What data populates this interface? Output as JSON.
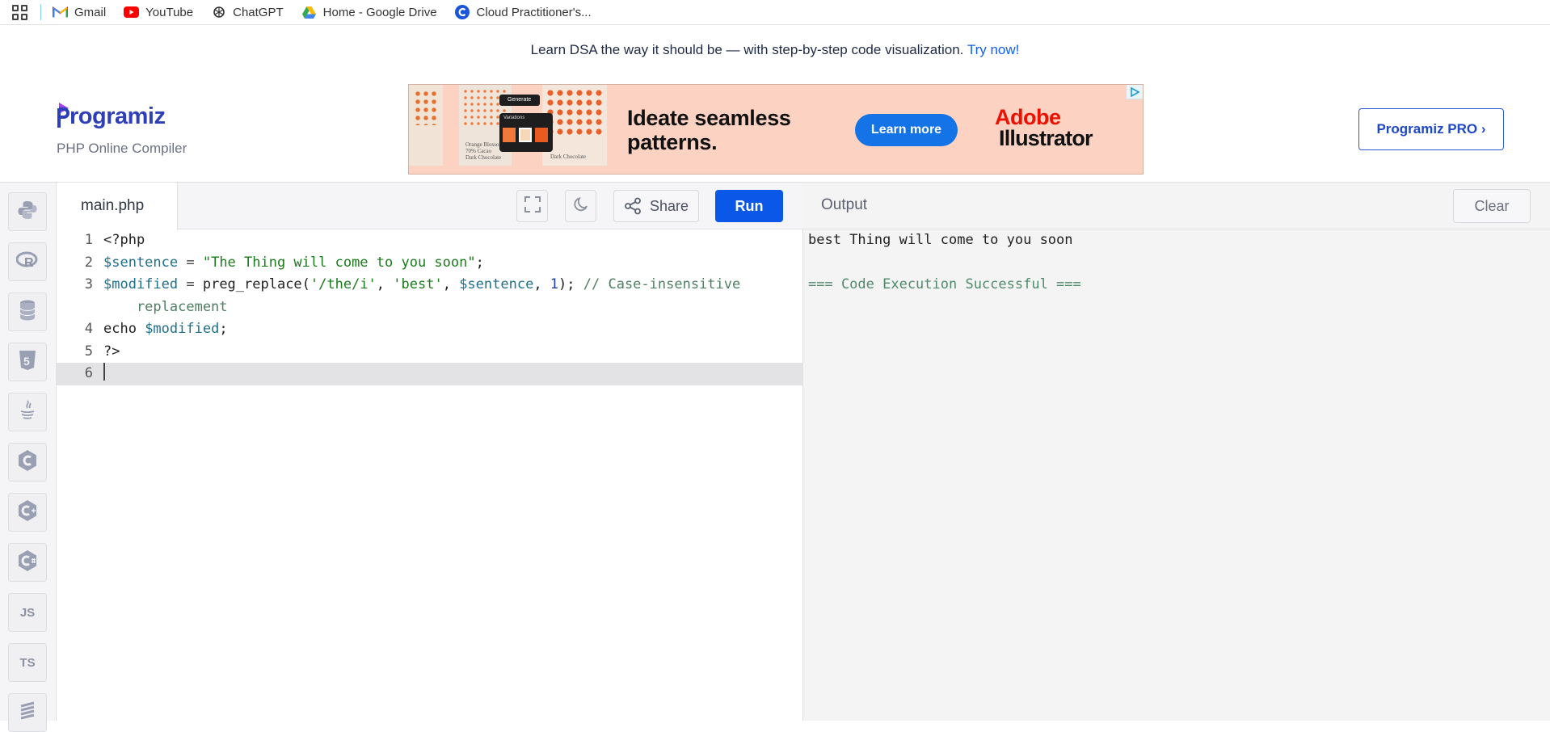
{
  "bookmarks": [
    {
      "label": "Gmail",
      "icon": "gmail-icon"
    },
    {
      "label": "YouTube",
      "icon": "youtube-icon"
    },
    {
      "label": "ChatGPT",
      "icon": "chatgpt-icon"
    },
    {
      "label": "Home - Google Drive",
      "icon": "google-drive-icon"
    },
    {
      "label": "Cloud Practitioner's...",
      "icon": "cloud-c-icon"
    }
  ],
  "promo": {
    "text": "Learn DSA the way it should be — with step-by-step code visualization.",
    "link": "Try now!"
  },
  "header": {
    "logo": "rogramiz",
    "subtitle": "PHP Online Compiler",
    "pro_button": "Programiz PRO ›"
  },
  "ad": {
    "headline_line1": "Ideate seamless",
    "headline_line2": "patterns.",
    "cta": "Learn more",
    "brand_line1": "Adobe",
    "brand_line2": "Illustrator",
    "generate_label": "Generate",
    "variations_label": "Variations",
    "thumb_label_1": "Orange Blossom",
    "thumb_label_2": "70% Cacao",
    "thumb_label_3": "Dark Chocolate",
    "thumb_label_4": "Dark Chocolate"
  },
  "languages": [
    {
      "name": "python-icon",
      "text": ""
    },
    {
      "name": "r-icon",
      "text": "R"
    },
    {
      "name": "sql-icon",
      "text": ""
    },
    {
      "name": "html5-icon",
      "text": "5"
    },
    {
      "name": "java-icon",
      "text": ""
    },
    {
      "name": "c-icon",
      "text": "C"
    },
    {
      "name": "cpp-icon",
      "text": "C"
    },
    {
      "name": "csharp-icon",
      "text": "C"
    },
    {
      "name": "js-icon",
      "text": "JS"
    },
    {
      "name": "ts-icon",
      "text": "TS"
    }
  ],
  "editor": {
    "filename": "main.php",
    "share_label": "Share",
    "run_label": "Run",
    "line_numbers": [
      "1",
      "2",
      "3",
      "",
      "4",
      "5",
      "6"
    ],
    "code": {
      "l1": "<?php",
      "l2_var": "$sentence",
      "l2_op": " = ",
      "l2_str": "\"The Thing will come to you soon\"",
      "l2_end": ";",
      "l3_var": "$modified",
      "l3_op": " = ",
      "l3_fn": "preg_replace(",
      "l3_str1": "'/the/i'",
      "l3_c1": ", ",
      "l3_str2": "'best'",
      "l3_c2": ", ",
      "l3_var2": "$sentence",
      "l3_c3": ", ",
      "l3_num": "1",
      "l3_end": "); ",
      "l3_com": "// Case-insensitive",
      "l3_wrap": "    replacement",
      "l4_kw": "echo ",
      "l4_var": "$modified",
      "l4_end": ";",
      "l5": "?>"
    }
  },
  "output": {
    "title": "Output",
    "clear_label": "Clear",
    "result": "best Thing will come to you soon",
    "status": "=== Code Execution Successful ==="
  },
  "colors": {
    "run": "#0b58e8",
    "brand": "#2e3fb8",
    "accent_link": "#0d5ff5"
  }
}
